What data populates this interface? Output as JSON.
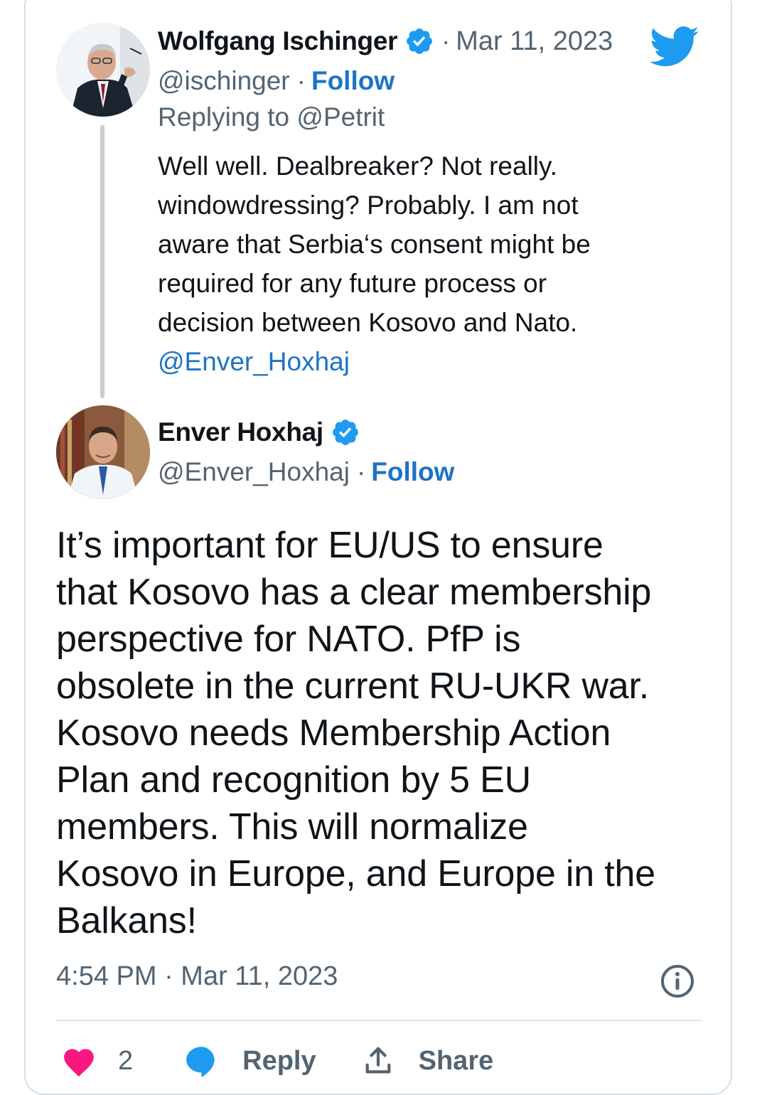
{
  "colors": {
    "verified_blue": "#1d9bf0",
    "link_blue": "#1d73c7",
    "secondary_text": "#536471",
    "primary_text": "#0f1419",
    "heart_pink": "#f91880",
    "divider": "#dfe4e8"
  },
  "parent_tweet": {
    "display_name": "Wolfgang Ischinger",
    "verified_icon": "verified-badge-icon",
    "separator": "·",
    "date": "Mar 11, 2023",
    "handle": "@ischinger",
    "handle_separator": "·",
    "follow_label": "Follow",
    "replying_to": "Replying to @Petrit",
    "body_lines": [
      "Well well. Dealbreaker? Not really.",
      "windowdressing? Probably. I am not",
      "aware that Serbia‘s consent might be",
      "required for any future process or",
      "decision between Kosovo and Nato."
    ],
    "mention": "@Enver_Hoxhaj"
  },
  "main_tweet": {
    "display_name": "Enver Hoxhaj",
    "verified_icon": "verified-badge-icon",
    "handle": "@Enver_Hoxhaj",
    "handle_separator": "·",
    "follow_label": "Follow",
    "body_lines": [
      "It’s important for EU/US to ensure",
      "that Kosovo has a clear membership",
      "perspective for NATO. PfP is",
      "obsolete in the current RU-UKR war.",
      "Kosovo needs Membership Action",
      "Plan and recognition by 5 EU",
      "members. This will normalize",
      "Kosovo in Europe, and Europe in the",
      "Balkans!"
    ],
    "timestamp": "4:54 PM · Mar 11, 2023",
    "like_count": "2",
    "reply_label": "Reply",
    "share_label": "Share"
  },
  "icons": {
    "brand": "twitter-bird-icon",
    "info": "info-icon",
    "like": "heart-icon",
    "reply": "reply-bubble-icon",
    "share": "share-icon"
  }
}
